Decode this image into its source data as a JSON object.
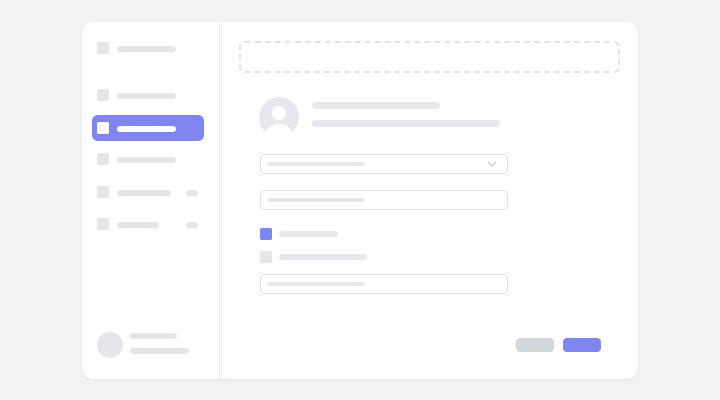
{
  "colors": {
    "background": "#f1f2f4",
    "window": "#ffffff",
    "accent": "#7f86f0",
    "placeholder": "#e4e6e9",
    "border": "#dfe1e5",
    "secondary_button": "#d3d6db"
  },
  "sidebar": {
    "active_index": 2,
    "items": [
      {
        "name": "app-logo",
        "has_badge": false
      },
      {
        "name": "nav-item-1",
        "has_badge": false
      },
      {
        "name": "nav-item-2",
        "has_badge": false,
        "active": true
      },
      {
        "name": "nav-item-3",
        "has_badge": false
      },
      {
        "name": "nav-item-4",
        "has_badge": true
      },
      {
        "name": "nav-item-5",
        "has_badge": true
      }
    ],
    "user": {
      "avatar_icon": "user-avatar-icon"
    }
  },
  "form": {
    "upload_area": "dashed-dropzone",
    "profile_icon": "user-avatar-icon",
    "select_icon": "chevron-down-icon",
    "checkboxes": [
      {
        "checked": true
      },
      {
        "checked": false
      }
    ]
  }
}
